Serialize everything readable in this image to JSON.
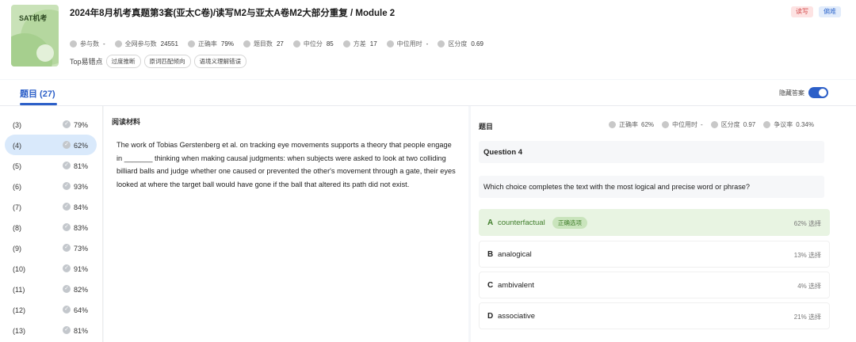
{
  "header": {
    "cover_text": "SAT机考",
    "title": "2024年8月机考真题第3套(亚太C卷)/读写M2与亚太A卷M2大部分重复 / Module 2",
    "tags": [
      "读写",
      "偏难"
    ],
    "stats": [
      {
        "icon": "users-icon",
        "label": "参与数",
        "value": "-"
      },
      {
        "icon": "user-icon",
        "label": "全网参与数",
        "value": "24551"
      },
      {
        "icon": "check-circle-icon",
        "label": "正确率",
        "value": "79%"
      },
      {
        "icon": "checkbox-icon",
        "label": "题目数",
        "value": "27"
      },
      {
        "icon": "median-icon",
        "label": "中位分",
        "value": "85"
      },
      {
        "icon": "variance-icon",
        "label": "方差",
        "value": "17"
      },
      {
        "icon": "clock-icon",
        "label": "中位用时",
        "value": "-"
      },
      {
        "icon": "target-icon",
        "label": "区分度",
        "value": "0.69"
      }
    ],
    "top_errors_label": "Top易错点",
    "top_errors": [
      "过度推断",
      "原词匹配倾向",
      "语境义理解错误"
    ]
  },
  "tabs": {
    "active": "题目 (27)",
    "hide_answer_label": "隐藏答案",
    "hide_answer_on": true
  },
  "questions": [
    {
      "num": "(3)",
      "pct": "79%",
      "active": false
    },
    {
      "num": "(4)",
      "pct": "62%",
      "active": true
    },
    {
      "num": "(5)",
      "pct": "81%",
      "active": false
    },
    {
      "num": "(6)",
      "pct": "93%",
      "active": false
    },
    {
      "num": "(7)",
      "pct": "84%",
      "active": false
    },
    {
      "num": "(8)",
      "pct": "83%",
      "active": false
    },
    {
      "num": "(9)",
      "pct": "73%",
      "active": false
    },
    {
      "num": "(10)",
      "pct": "91%",
      "active": false
    },
    {
      "num": "(11)",
      "pct": "82%",
      "active": false
    },
    {
      "num": "(12)",
      "pct": "64%",
      "active": false
    },
    {
      "num": "(13)",
      "pct": "81%",
      "active": false
    }
  ],
  "passage": {
    "heading": "阅读材料",
    "text": "The work of Tobias Gerstenberg et al. on tracking eye movements supports a theory that people engage in _______ thinking when making causal judgments: when subjects were asked to look at two colliding billiard balls and judge whether one caused or prevented the other's movement through a gate, their eyes looked at where the target ball would have gone if the ball that altered its path did not exist."
  },
  "question_panel": {
    "heading": "题目",
    "metrics": [
      {
        "icon": "check-circle-icon",
        "label": "正确率",
        "value": "62%"
      },
      {
        "icon": "clock-icon",
        "label": "中位用时",
        "value": "-"
      },
      {
        "icon": "target-icon",
        "label": "区分度",
        "value": "0.97"
      },
      {
        "icon": "warning-icon",
        "label": "争议率",
        "value": "0.34%"
      }
    ],
    "title": "Question 4",
    "stem": "Which choice completes the text with the most logical and precise word or phrase?",
    "options": [
      {
        "key": "A",
        "text": "counterfactual",
        "badge": "正确选项",
        "pct": "62% 选择",
        "correct": true
      },
      {
        "key": "B",
        "text": "analogical",
        "badge": "",
        "pct": "13% 选择",
        "correct": false
      },
      {
        "key": "C",
        "text": "ambivalent",
        "badge": "",
        "pct": "4% 选择",
        "correct": false
      },
      {
        "key": "D",
        "text": "associative",
        "badge": "",
        "pct": "21% 选择",
        "correct": false
      }
    ]
  },
  "colors": {
    "accent": "#2c5fc8",
    "correct_bg": "#e8f4e2",
    "correct_text": "#3f7d2a"
  }
}
